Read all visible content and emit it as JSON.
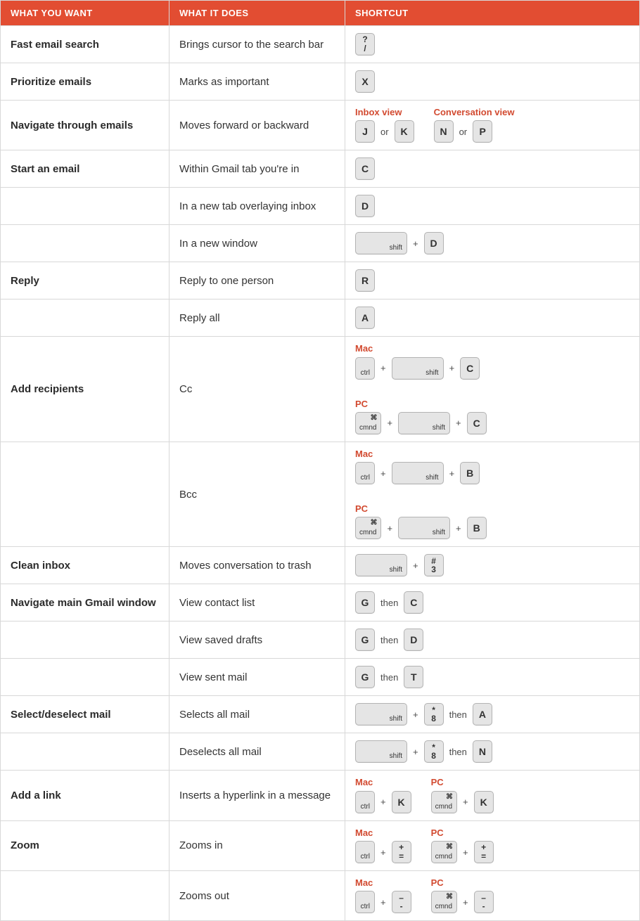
{
  "headers": {
    "want": "WHAT YOU WANT",
    "does": "WHAT IT DOES",
    "shortcut": "SHORTCUT"
  },
  "joiners": {
    "plus": "+",
    "or": "or",
    "then": "then"
  },
  "labels": {
    "inbox_view": "Inbox view",
    "conversation_view": "Conversation view",
    "mac": "Mac",
    "pc": "PC"
  },
  "keys": {
    "ctrl": "ctrl",
    "cmnd": "cmnd",
    "shift": "shift",
    "J": "J",
    "K": "K",
    "N": "N",
    "P": "P",
    "C": "C",
    "D": "D",
    "R": "R",
    "A": "A",
    "B": "B",
    "G": "G",
    "T": "T",
    "X": "X",
    "qslash_top": "?",
    "qslash_bot": "/",
    "hash_top": "#",
    "hash_bot": "3",
    "star_top": "*",
    "star_bot": "8",
    "plus_top": "+",
    "plus_bot": "=",
    "minus_top": "–",
    "minus_bot": "-",
    "cmd_sym": "⌘"
  },
  "rows": [
    {
      "want": "Fast email search",
      "does": "Brings cursor to the search bar"
    },
    {
      "want": "Prioritize emails",
      "does": "Marks as important"
    },
    {
      "want": "Navigate through emails",
      "does": "Moves forward or backward"
    },
    {
      "want": "Start an email",
      "does": "Within Gmail tab you're in"
    },
    {
      "want": "",
      "does": "In a new tab overlaying inbox"
    },
    {
      "want": "",
      "does": "In a new window"
    },
    {
      "want": "Reply",
      "does": "Reply to one person"
    },
    {
      "want": "",
      "does": "Reply all"
    },
    {
      "want": "Add recipients",
      "does": "Cc"
    },
    {
      "want": "",
      "does": "Bcc"
    },
    {
      "want": "Clean inbox",
      "does": "Moves conversation to trash"
    },
    {
      "want": "Navigate main Gmail window",
      "does": "View contact list"
    },
    {
      "want": "",
      "does": "View saved drafts"
    },
    {
      "want": "",
      "does": "View sent mail"
    },
    {
      "want": "Select/deselect mail",
      "does": "Selects all mail"
    },
    {
      "want": "",
      "does": "Deselects all mail"
    },
    {
      "want": "Add a link",
      "does": "Inserts a hyperlink in a message"
    },
    {
      "want": "Zoom",
      "does": "Zooms in"
    },
    {
      "want": "",
      "does": "Zooms out"
    }
  ]
}
